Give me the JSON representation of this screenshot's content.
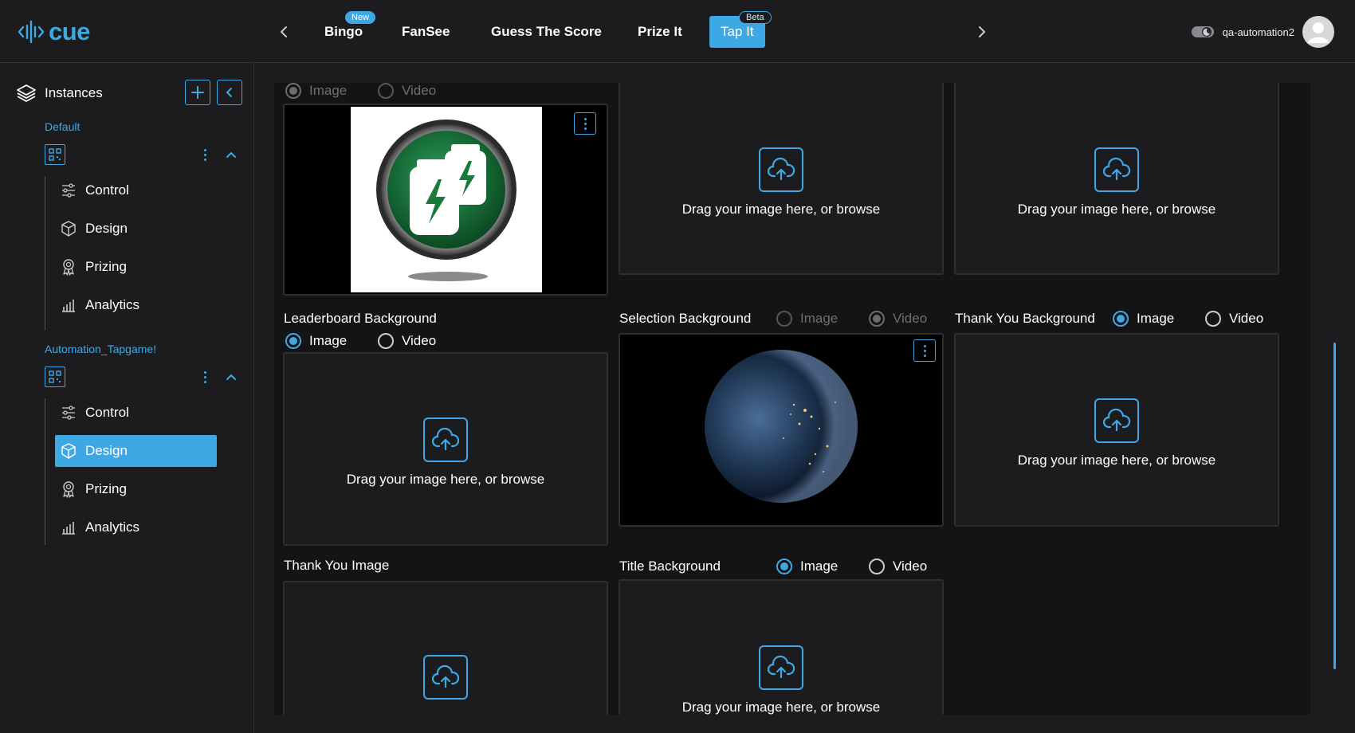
{
  "header": {
    "logo_text": "cue",
    "tabs": [
      {
        "label": "Bingo",
        "badge": "New"
      },
      {
        "label": "FanSee"
      },
      {
        "label": "Guess The Score"
      },
      {
        "label": "Prize It"
      },
      {
        "label": "Tap It",
        "badge": "Beta",
        "active": true
      }
    ],
    "username": "qa-automation2",
    "accent_color": "#3ea8e5"
  },
  "sidebar": {
    "title": "Instances",
    "groups": [
      {
        "title": "Default",
        "items": [
          {
            "label": "Control",
            "icon": "sliders-icon"
          },
          {
            "label": "Design",
            "icon": "cube-icon"
          },
          {
            "label": "Prizing",
            "icon": "award-icon"
          },
          {
            "label": "Analytics",
            "icon": "bar-chart-icon"
          }
        ]
      },
      {
        "title": "Automation_Tapgame!",
        "items": [
          {
            "label": "Control",
            "icon": "sliders-icon"
          },
          {
            "label": "Design",
            "icon": "cube-icon",
            "active": true
          },
          {
            "label": "Prizing",
            "icon": "award-icon"
          },
          {
            "label": "Analytics",
            "icon": "bar-chart-icon"
          }
        ]
      }
    ]
  },
  "main": {
    "radio_image": "Image",
    "radio_video": "Video",
    "drop_text": "Drag your image here, or browse",
    "fields": {
      "top_left": {
        "selected": "Image"
      },
      "leaderboard": {
        "label": "Leaderboard Background",
        "selected": "Image"
      },
      "selection": {
        "label": "Selection Background",
        "selected": "Video"
      },
      "thank_you_bg": {
        "label": "Thank You Background",
        "selected": "Image"
      },
      "thank_you_image": {
        "label": "Thank You Image"
      },
      "title_bg": {
        "label": "Title Background",
        "selected": "Image"
      }
    }
  }
}
